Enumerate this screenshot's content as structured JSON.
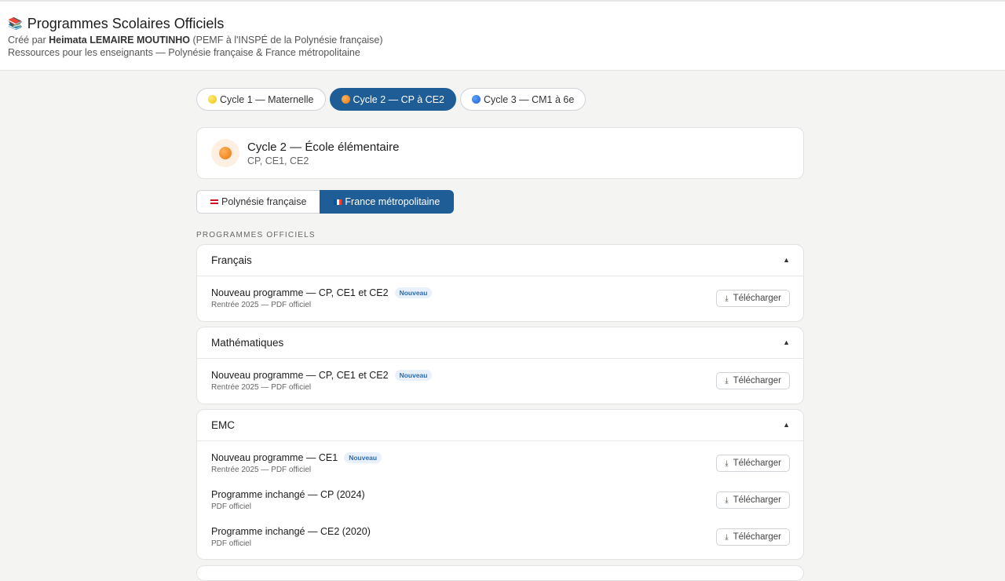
{
  "header": {
    "icon": "books-icon",
    "title": "Programmes Scolaires Officiels",
    "created_prefix": "Créé par ",
    "author": "Heimata LEMAIRE MOUTINHO",
    "created_suffix": " (PEMF à l'INSPÉ de la Polynésie française)",
    "resources": "Ressources pour les enseignants — Polynésie française & France métropolitaine"
  },
  "cycle_tabs": [
    {
      "label": "Cycle 1 — Maternelle",
      "icon": "yellow-dot-icon",
      "active": false
    },
    {
      "label": "Cycle 2 — CP à CE2",
      "icon": "orange-dot-icon",
      "active": true
    },
    {
      "label": "Cycle 3 — CM1 à 6e",
      "icon": "blue-dot-icon",
      "active": false
    }
  ],
  "cycle_card": {
    "title": "Cycle 2 — École élémentaire",
    "levels": "CP, CE1, CE2"
  },
  "region_tabs": [
    {
      "label": "Polynésie française",
      "icon": "polynesia-flag-icon",
      "active": false
    },
    {
      "label": "France métropolitaine",
      "icon": "france-flag-icon",
      "active": true
    }
  ],
  "section_label": "PROGRAMMES OFFICIELS",
  "download_label": "Télécharger",
  "new_badge": "Nouveau",
  "subjects": [
    {
      "title": "Français",
      "docs": [
        {
          "title": "Nouveau programme — CP, CE1 et CE2",
          "subtitle": "Rentrée 2025 — PDF officiel",
          "new": true
        }
      ]
    },
    {
      "title": "Mathématiques",
      "docs": [
        {
          "title": "Nouveau programme — CP, CE1 et CE2",
          "subtitle": "Rentrée 2025 — PDF officiel",
          "new": true
        }
      ]
    },
    {
      "title": "EMC",
      "docs": [
        {
          "title": "Nouveau programme — CE1",
          "subtitle": "Rentrée 2025 — PDF officiel",
          "new": true
        },
        {
          "title": "Programme inchangé — CP (2024)",
          "subtitle": "PDF officiel",
          "new": false
        },
        {
          "title": "Programme inchangé — CE2 (2020)",
          "subtitle": "PDF officiel",
          "new": false
        }
      ]
    }
  ],
  "colors": {
    "accent": "#1f5d96",
    "badge_text": "#2a6cb0",
    "badge_bg": "#e8f1fb"
  }
}
